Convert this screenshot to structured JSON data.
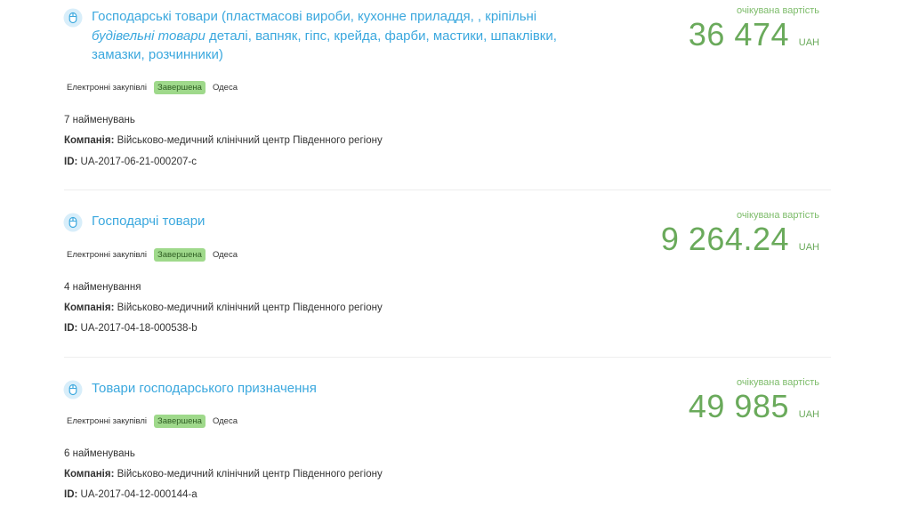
{
  "tenders": [
    {
      "title_parts": [
        {
          "text": "Господарські товари (пластмасові вироби, кухонне приладдя, , кріпільні ",
          "italic": false
        },
        {
          "text": "будівельні товари",
          "italic": true
        },
        {
          "text": "  деталі, вапняк, гіпс, крейда, фарби, мастики, шпаклівки, замазки, розчинники)",
          "italic": false
        }
      ],
      "procurement_type": "Електронні закупівлі",
      "status": "Завершена",
      "city": "Одеса",
      "items_count": "7 найменувань",
      "company_label": "Компанія:",
      "company": "Військово-медичний клінічний центр Південного регіону",
      "id_label": "ID:",
      "id": "UA-2017-06-21-000207-c",
      "price_label": "очікувана вартість",
      "price": "36 474",
      "currency": "UAH"
    },
    {
      "title_parts": [
        {
          "text": "Господарчі товари",
          "italic": false
        }
      ],
      "procurement_type": "Електронні закупівлі",
      "status": "Завершена",
      "city": "Одеса",
      "items_count": "4 найменування",
      "company_label": "Компанія:",
      "company": "Військово-медичний клінічний центр Південного регіону",
      "id_label": "ID:",
      "id": "UA-2017-04-18-000538-b",
      "price_label": "очікувана вартість",
      "price": "9 264.24",
      "currency": "UAH"
    },
    {
      "title_parts": [
        {
          "text": "Товари господарського призначення",
          "italic": false
        }
      ],
      "procurement_type": "Електронні закупівлі",
      "status": "Завершена",
      "city": "Одеса",
      "items_count": "6 найменувань",
      "company_label": "Компанія:",
      "company": "Військово-медичний клінічний центр Південного регіону",
      "id_label": "ID:",
      "id": "UA-2017-04-12-000144-a",
      "price_label": "очікувана вартість",
      "price": "49 985",
      "currency": "UAH"
    }
  ],
  "colors": {
    "link": "#3ba8de",
    "price": "#6aaa5b",
    "status_badge": "#9fd98b"
  },
  "icons": {
    "tender_icon": "mouse-icon"
  }
}
